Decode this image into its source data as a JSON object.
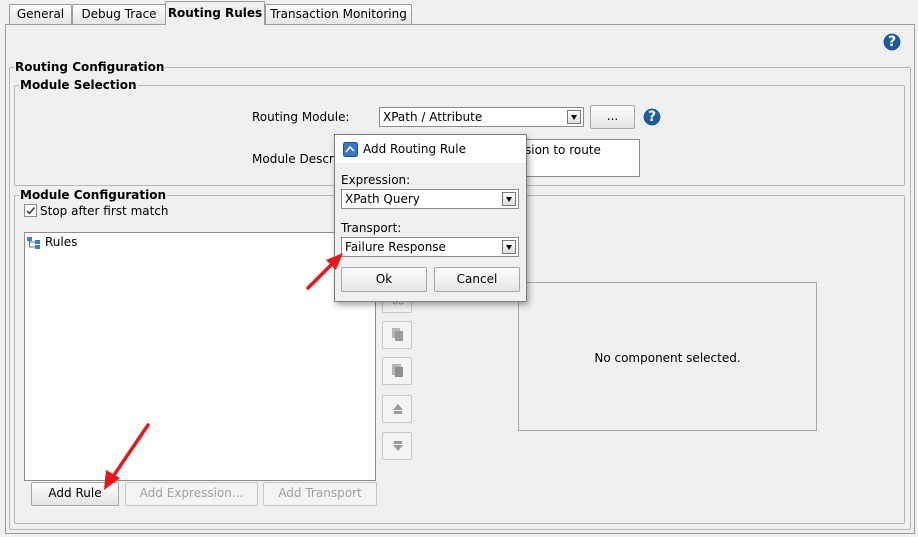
{
  "tabs": [
    {
      "label": "General"
    },
    {
      "label": "Debug Trace"
    },
    {
      "label": "Routing Rules"
    },
    {
      "label": "Transaction Monitoring"
    }
  ],
  "help_icon_glyph": "?",
  "routing_configuration": {
    "title": "Routing Configuration",
    "module_selection": {
      "title": "Module Selection",
      "routing_module_label": "Routing Module:",
      "routing_module_value": "XPath / Attribute",
      "browse_button": "...",
      "module_description_label": "Module Descrip",
      "module_description_value": "sion to route"
    },
    "module_configuration": {
      "title": "Module Configuration",
      "stop_after_first_match": {
        "label": "Stop after first match",
        "checked": true
      },
      "tree_root": "Rules",
      "empty_state": "No component selected.",
      "add_rule_button": "Add Rule",
      "add_expression_button": "Add Expression...",
      "add_transport_button": "Add Transport"
    }
  },
  "dialog": {
    "title": "Add Routing Rule",
    "expression_label": "Expression:",
    "expression_value": "XPath Query",
    "transport_label": "Transport:",
    "transport_value": "Failure Response",
    "ok_button": "Ok",
    "cancel_button": "Cancel"
  },
  "colors": {
    "annotation_arrow": "#e8161a",
    "help_icon": "#1f5a9e"
  }
}
